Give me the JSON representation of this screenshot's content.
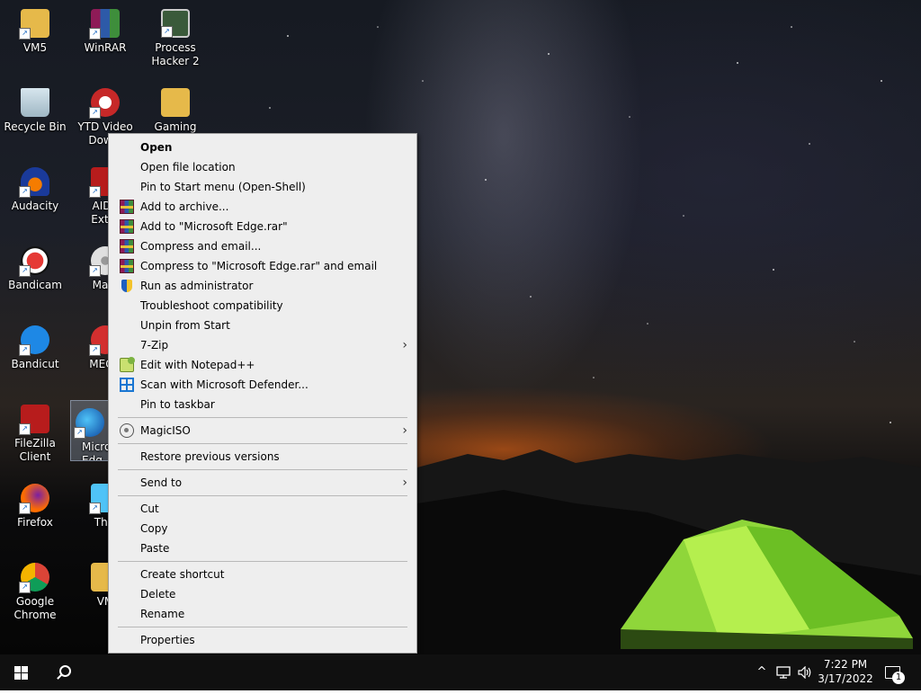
{
  "desktop_icons": [
    {
      "label": "VM5"
    },
    {
      "label": "WinRAR"
    },
    {
      "label": "Process\nHacker 2"
    },
    {
      "label": "Recycle Bin"
    },
    {
      "label": "YTD Video\nDownl"
    },
    {
      "label": "Gaming"
    },
    {
      "label": "Audacity"
    },
    {
      "label": "AIDA\nExtre"
    },
    {
      "label": "Bandicam"
    },
    {
      "label": "Magi"
    },
    {
      "label": "Bandicut"
    },
    {
      "label": "MEGA"
    },
    {
      "label": "FileZilla Client"
    },
    {
      "label": "Micro\nEdg"
    },
    {
      "label": "Firefox"
    },
    {
      "label": "This"
    },
    {
      "label": "Google\nChrome"
    },
    {
      "label": "VM"
    }
  ],
  "context_menu": {
    "items": [
      {
        "label": "Open"
      },
      {
        "label": "Open file location"
      },
      {
        "label": "Pin to Start menu (Open-Shell)"
      },
      {
        "label": "Add to archive..."
      },
      {
        "label": "Add to \"Microsoft Edge.rar\""
      },
      {
        "label": "Compress and email..."
      },
      {
        "label": "Compress to \"Microsoft Edge.rar\" and email"
      },
      {
        "label": "Run as administrator"
      },
      {
        "label": "Troubleshoot compatibility"
      },
      {
        "label": "Unpin from Start"
      },
      {
        "label": "7-Zip"
      },
      {
        "label": "Edit with Notepad++"
      },
      {
        "label": "Scan with Microsoft Defender..."
      },
      {
        "label": "Pin to taskbar"
      },
      {
        "label": "MagicISO"
      },
      {
        "label": "Restore previous versions"
      },
      {
        "label": "Send to"
      },
      {
        "label": "Cut"
      },
      {
        "label": "Copy"
      },
      {
        "label": "Paste"
      },
      {
        "label": "Create shortcut"
      },
      {
        "label": "Delete"
      },
      {
        "label": "Rename"
      },
      {
        "label": "Properties"
      }
    ],
    "submenu_arrow": "›"
  },
  "taskbar": {
    "clock_time": "7:22 PM",
    "clock_date": "3/17/2022",
    "tray_chevron": "^",
    "notification_count": "1"
  }
}
